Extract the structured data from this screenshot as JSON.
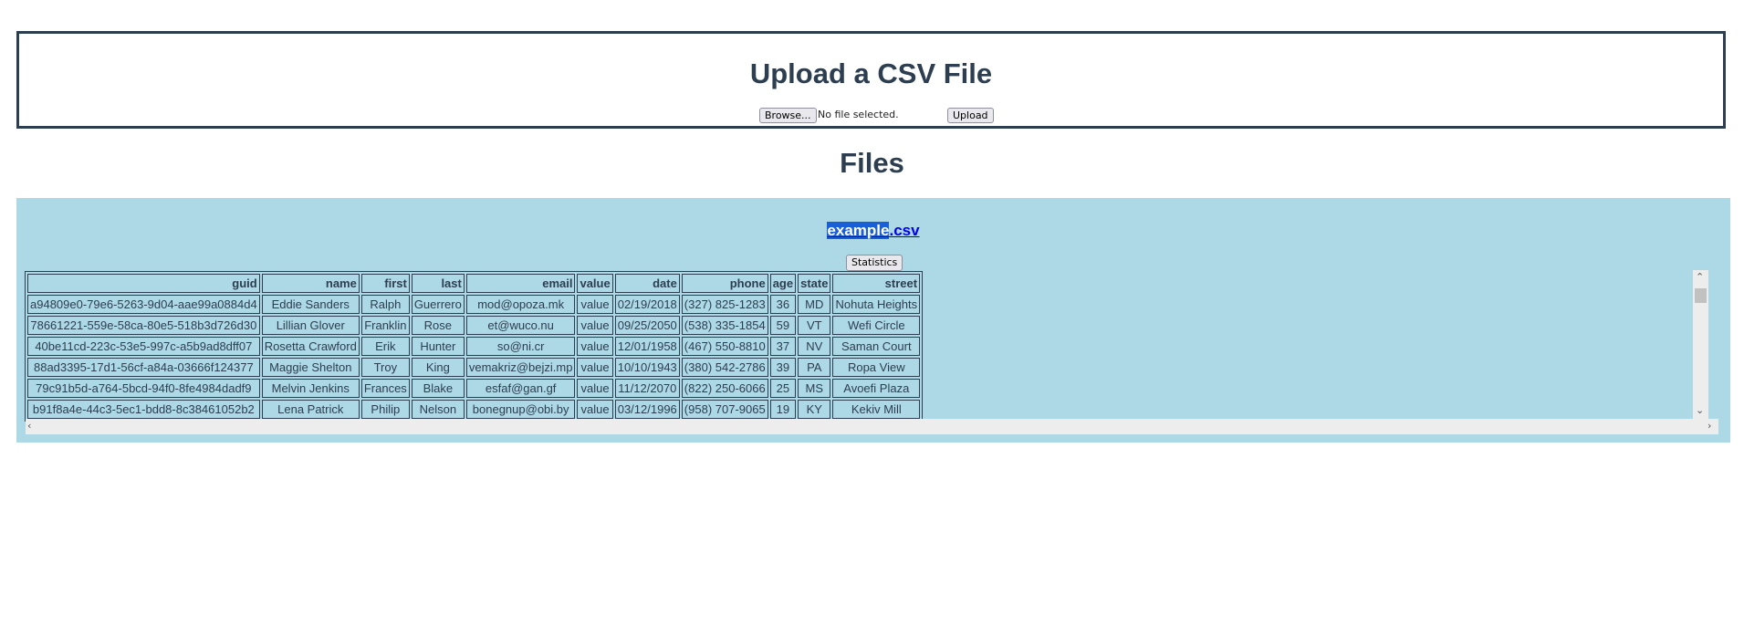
{
  "upload": {
    "title": "Upload a CSV File",
    "browse_label": "Browse...",
    "file_status": "No file selected.",
    "upload_label": "Upload"
  },
  "files": {
    "heading": "Files",
    "file_name_selected": "example",
    "file_name_rest": ".csv",
    "statistics_label": "Statistics"
  },
  "table": {
    "columns": [
      "guid",
      "name",
      "first",
      "last",
      "email",
      "value",
      "date",
      "phone",
      "age",
      "state",
      "street"
    ],
    "rows": [
      [
        "a94809e0-79e6-5263-9d04-aae99a0884d4",
        "Eddie Sanders",
        "Ralph",
        "Guerrero",
        "mod@opoza.mk",
        "value",
        "02/19/2018",
        "(327) 825-1283",
        "36",
        "MD",
        "Nohuta Heights"
      ],
      [
        "78661221-559e-58ca-80e5-518b3d726d30",
        "Lillian Glover",
        "Franklin",
        "Rose",
        "et@wuco.nu",
        "value",
        "09/25/2050",
        "(538) 335-1854",
        "59",
        "VT",
        "Wefi Circle"
      ],
      [
        "40be11cd-223c-53e5-997c-a5b9ad8dff07",
        "Rosetta Crawford",
        "Erik",
        "Hunter",
        "so@ni.cr",
        "value",
        "12/01/1958",
        "(467) 550-8810",
        "37",
        "NV",
        "Saman Court"
      ],
      [
        "88ad3395-17d1-56cf-a84a-03666f124377",
        "Maggie Shelton",
        "Troy",
        "King",
        "vemakriz@bejzi.mp",
        "value",
        "10/10/1943",
        "(380) 542-2786",
        "39",
        "PA",
        "Ropa View"
      ],
      [
        "79c91b5d-a764-5bcd-94f0-8fe4984dadf9",
        "Melvin Jenkins",
        "Frances",
        "Blake",
        "esfaf@gan.gf",
        "value",
        "11/12/2070",
        "(822) 250-6066",
        "25",
        "MS",
        "Avoefi Plaza"
      ],
      [
        "b91f8a4e-44c3-5ec1-bdd8-8c38461052b2",
        "Lena Patrick",
        "Philip",
        "Nelson",
        "bonegnup@obi.by",
        "value",
        "03/12/1996",
        "(958) 707-9065",
        "19",
        "KY",
        "Kekiv Mill"
      ]
    ]
  },
  "icons": {
    "scroll_up": "chevron-up-icon",
    "scroll_down": "chevron-down-icon",
    "scroll_left": "chevron-left-icon",
    "scroll_right": "chevron-right-icon"
  }
}
